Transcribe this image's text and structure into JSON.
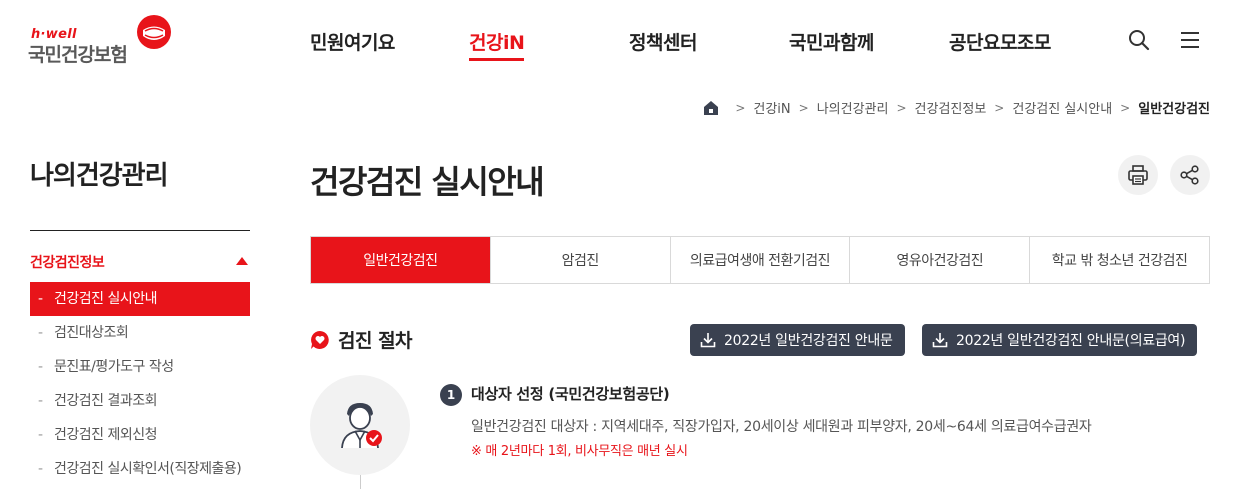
{
  "brand": {
    "tagline": "h·well",
    "name": "국민건강보험",
    "accent_color": "#e8141a",
    "dark_color": "#3a4150"
  },
  "nav": {
    "items": [
      {
        "label": "민원여기요"
      },
      {
        "label": "건강iN"
      },
      {
        "label": "정책센터"
      },
      {
        "label": "국민과함께"
      },
      {
        "label": "공단요모조모"
      }
    ],
    "active": "건강iN",
    "icons": [
      "search-icon",
      "hamburger-menu-icon"
    ]
  },
  "breadcrumb": {
    "home_icon": "home-icon",
    "items": [
      "건강iN",
      "나의건강관리",
      "건강검진정보",
      "건강검진 실시안내",
      "일반건강검진"
    ]
  },
  "sidebar": {
    "title": "나의건강관리",
    "section": "건강검진정보",
    "items": [
      {
        "label": "건강검진 실시안내"
      },
      {
        "label": "검진대상조회"
      },
      {
        "label": "문진표/평가도구 작성"
      },
      {
        "label": "건강검진 결과조회"
      },
      {
        "label": "건강검진 제외신청"
      },
      {
        "label": "건강검진 실시확인서(직장제출용)"
      }
    ],
    "active": "건강검진 실시안내",
    "bullet": "-"
  },
  "main": {
    "title": "건강검진 실시안내",
    "action_icons": [
      "print-icon",
      "share-icon"
    ],
    "tabs": [
      {
        "label": "일반건강검진"
      },
      {
        "label": "암검진"
      },
      {
        "label": "의료급여생애 전환기검진"
      },
      {
        "label": "영유아건강검진"
      },
      {
        "label": "학교 밖 청소년 건강검진"
      }
    ],
    "active_tab": "일반건강검진",
    "section": {
      "title": "검진 절차",
      "icon": "heart-chat-icon"
    },
    "downloads": [
      {
        "label": "2022년 일반건강검진 안내문",
        "icon": "download-icon"
      },
      {
        "label": "2022년 일반건강검진 안내문(의료급여)",
        "icon": "download-icon"
      }
    ],
    "steps": [
      {
        "number": "1",
        "title": "대상자 선정 (국민건강보험공단)",
        "description": "일반건강검진 대상자 : 지역세대주, 직장가입자, 20세이상 세대원과 피부양자, 20세~64세 의료급여수급권자",
        "note": "※ 매 2년마다 1회, 비사무직은 매년 실시",
        "icon": "person-check-icon"
      }
    ]
  }
}
